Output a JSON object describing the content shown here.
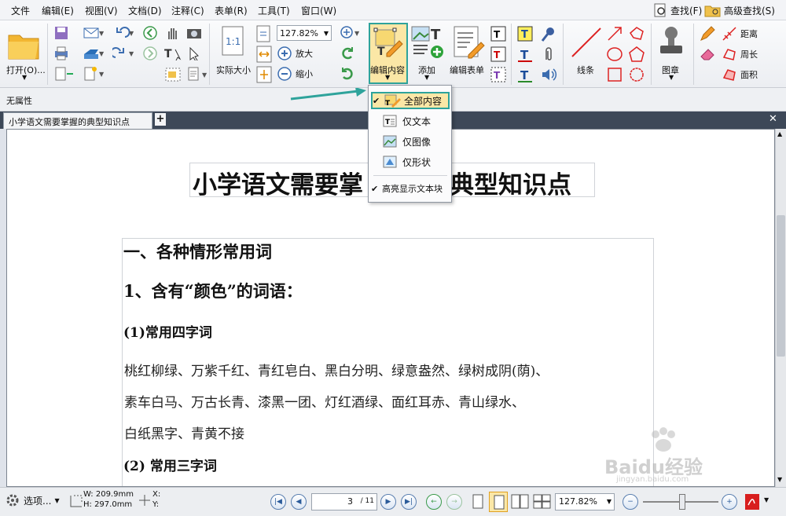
{
  "menu": [
    "文件",
    "编辑(E)",
    "视图(V)",
    "文档(D)",
    "注释(C)",
    "表单(R)",
    "工具(T)",
    "窗口(W)"
  ],
  "menu_right": {
    "find": "查找(F)",
    "advanced_find": "高级查找(S)"
  },
  "ribbon": {
    "open": "打开(O)...",
    "actual_size": "实际大小",
    "zoom_value": "127.82%",
    "zoom_in": "放大",
    "zoom_out": "缩小",
    "edit_content": "编辑内容",
    "add": "添加",
    "edit_form": "编辑表单",
    "lines": "线条",
    "stamp": "图章",
    "distance": "距离",
    "perimeter": "周长",
    "area": "面积"
  },
  "property_bar": "无属性",
  "tab": {
    "title": "小学语文需要掌握的典型知识点"
  },
  "dropdown": {
    "all": "全部内容",
    "text_only": "仅文本",
    "image_only": "仅图像",
    "shape_only": "仅形状",
    "highlight": "高亮显示文本块"
  },
  "document": {
    "title_left": "小学语文需要掌",
    "title_right": "典型知识点",
    "h1": "一、各种情形常用词",
    "h2": "1、含有“颜色”的词语：",
    "h3a": "(1)常用四字词",
    "p1": "桃红柳绿、万紫千红、青红皂白、黑白分明、绿意盎然、绿树成阴(荫)、",
    "p2": "素车白马、万古长青、漆黑一团、灯红酒绿、面红耳赤、青山绿水、",
    "p3": "白纸黑字、青黄不接",
    "h3b": "(2) 常用三字词"
  },
  "status": {
    "options": "选项...",
    "w": "W: 209.9mm",
    "h": "H: 297.0mm",
    "x": "X:",
    "y": "Y:",
    "page": "3",
    "total": "/ 11",
    "zoom": "127.82%"
  },
  "watermark": {
    "brand": "Baidu经验",
    "url": "jingyan.baidu.com"
  }
}
